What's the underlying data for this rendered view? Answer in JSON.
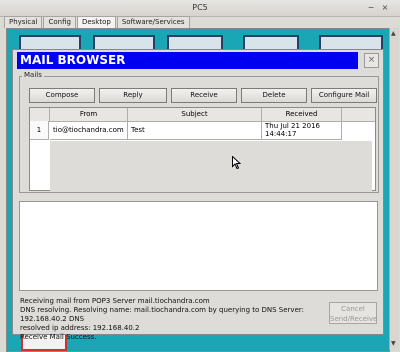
{
  "window": {
    "title": "PC5"
  },
  "tabs": [
    {
      "label": "Physical"
    },
    {
      "label": "Config"
    },
    {
      "label": "Desktop"
    },
    {
      "label": "Software/Services"
    }
  ],
  "mail_browser": {
    "title": "MAIL BROWSER",
    "close_label": "×",
    "group_label": "Mails",
    "buttons": {
      "compose": "Compose",
      "reply": "Reply",
      "receive": "Receive",
      "delete": "Delete",
      "configure": "Configure Mail"
    },
    "columns": [
      "From",
      "Subject",
      "Received"
    ],
    "rows": [
      {
        "num": "1",
        "from": "tio@tiochandra.com",
        "subject": "Test",
        "received_line1": "Thu Jul 21 2016",
        "received_line2": "14:44:17"
      }
    ],
    "log": {
      "line1": "Receiving mail from POP3 Server mail.tiochandra.com",
      "line2": "DNS resolving. Resolving name: mail.tiochandra.com by querying to DNS Server: 192.168.40.2 DNS",
      "line3": "resolved ip address: 192.168.40.2",
      "line4": "Receive Mail Success."
    },
    "send_receive": {
      "line1": "Cancel",
      "line2": "Send/Receive"
    }
  }
}
